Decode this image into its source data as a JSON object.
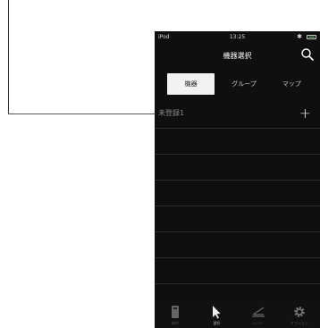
{
  "status": {
    "carrier": "iPod",
    "time": "13:25",
    "bluetooth": "✱",
    "battery_level": 1.0
  },
  "navbar": {
    "title": "機器選択"
  },
  "segments": [
    {
      "label": "機器",
      "active": true
    },
    {
      "label": "グループ",
      "active": false
    },
    {
      "label": "マップ",
      "active": false
    }
  ],
  "list": {
    "rows": [
      {
        "label": "未登録1",
        "action": "+"
      },
      {
        "label": ""
      },
      {
        "label": ""
      },
      {
        "label": ""
      },
      {
        "label": ""
      },
      {
        "label": ""
      },
      {
        "label": ""
      },
      {
        "label": ""
      }
    ]
  },
  "tabbar": {
    "items": [
      {
        "label": "操作",
        "icon": "remote-icon"
      },
      {
        "label": "選択",
        "icon": "pointer-icon",
        "active": true
      },
      {
        "label": "シーン",
        "icon": "scene-icon"
      },
      {
        "label": "オプション",
        "icon": "gear-icon"
      }
    ]
  },
  "colors": {
    "background": "#0f0f0f",
    "active_segment": "#f2f2f2",
    "battery": "#4cd964"
  }
}
